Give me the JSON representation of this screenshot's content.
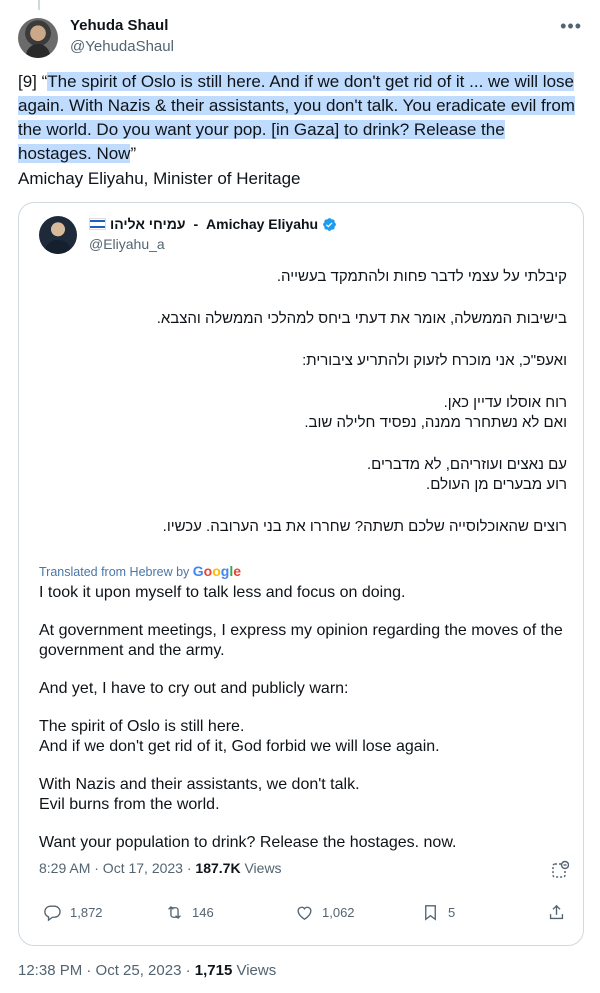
{
  "author": {
    "name": "Yehuda Shaul",
    "handle": "@YehudaShaul"
  },
  "tweet": {
    "prefix": "[9] “",
    "highlighted": "The spirit of Oslo is still here. And if we don't get rid of it ... we will lose again. With Nazis & their assistants, you don't talk. You eradicate evil from the world. Do you want your pop. [in Gaza] to drink? Release the hostages. Now",
    "suffix": "”",
    "attribution": "Amichay Eliyahu, Minister of Heritage"
  },
  "quoted": {
    "name_hebrew": "עמיחי אליהו",
    "name_sep": " - ",
    "name_english": "Amichay Eliyahu",
    "handle": "@Eliyahu_a",
    "hebrew_lines": [
      "קיבלתי על עצמי לדבר פחות ולהתמקד בעשייה.",
      "בישיבות הממשלה, אומר את דעתי ביחס למהלכי הממשלה והצבא.",
      "ואעפ\"כ, אני מוכרח לזעוק ולהתריע ציבורית:",
      "רוח אוסלו עדיין כאן.",
      "ואם לא נשתחרר ממנה, נפסיד חלילה שוב.",
      "עם נאצים ועוזריהם, לא מדברים.",
      "רוע מבערים מן העולם.",
      "רוצים שהאוכלוסייה שלכם תשתה? שחררו את בני הערובה. עכשיו."
    ],
    "translated_label": "Translated from Hebrew by",
    "google": [
      "G",
      "o",
      "o",
      "g",
      "l",
      "e"
    ],
    "translation_lines": [
      "I took it upon myself to talk less and focus on doing.",
      "At government meetings, I express my opinion regarding the moves of the government and the army.",
      "And yet, I have to cry out and publicly warn:",
      "The spirit of Oslo is still here.",
      "And if we don't get rid of it, God forbid we will lose again.",
      "With Nazis and their assistants, we don't talk.",
      "Evil burns from the world.",
      "Want your population to drink? Release the hostages. now."
    ],
    "time": "8:29 AM · Oct 17, 2023 · ",
    "views_count": "187.7K",
    "views_label": " Views",
    "replies": "1,872",
    "reposts": "146",
    "likes": "1,062",
    "bookmarks": "5"
  },
  "footer": {
    "time": "12:38 PM · Oct 25, 2023 · ",
    "views_count": "1,715",
    "views_label": " Views"
  },
  "colors": {
    "highlight": "#bfdcff",
    "verified": "#1d9bf0",
    "muted": "#536471",
    "text": "#0f1419"
  },
  "icons": [
    "more-icon",
    "verified-icon",
    "flag-icon",
    "grok-icon",
    "reply-icon",
    "repost-icon",
    "like-icon",
    "bookmark-icon",
    "share-icon"
  ]
}
